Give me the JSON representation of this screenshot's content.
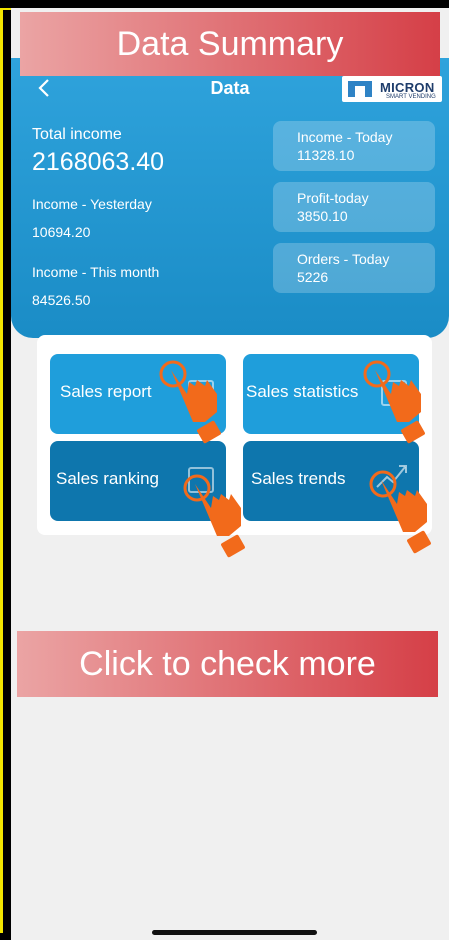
{
  "banners": {
    "top": "Data Summary",
    "bottom": "Click to check more"
  },
  "nav": {
    "back_icon": "chevron-left-icon",
    "title": "Data"
  },
  "logo": {
    "brand": "MICRON",
    "tagline": "SMART VENDING"
  },
  "summary": {
    "total_income_label": "Total income",
    "total_income_value": "2168063.40",
    "yesterday_label": "Income - Yesterday",
    "yesterday_value": "10694.20",
    "month_label": "Income - This month",
    "month_value": "84526.50"
  },
  "stats": [
    {
      "label": "Income - Today",
      "value": "11328.10"
    },
    {
      "label": "Profit-today",
      "value": "3850.10"
    },
    {
      "label": "Orders - Today",
      "value": "5226"
    }
  ],
  "tiles": [
    {
      "label": "Sales report",
      "icon": "report-icon"
    },
    {
      "label": "Sales statistics",
      "icon": "statistics-icon"
    },
    {
      "label": "Sales ranking",
      "icon": "ranking-icon"
    },
    {
      "label": "Sales trends",
      "icon": "trend-icon"
    }
  ],
  "colors": {
    "header": "#1f9edb",
    "tile_light": "#1f9edb",
    "tile_dark": "#0e76ad",
    "banner": "#d53f47",
    "hand": "#f26a1b",
    "frame_accent": "#f3e600"
  }
}
